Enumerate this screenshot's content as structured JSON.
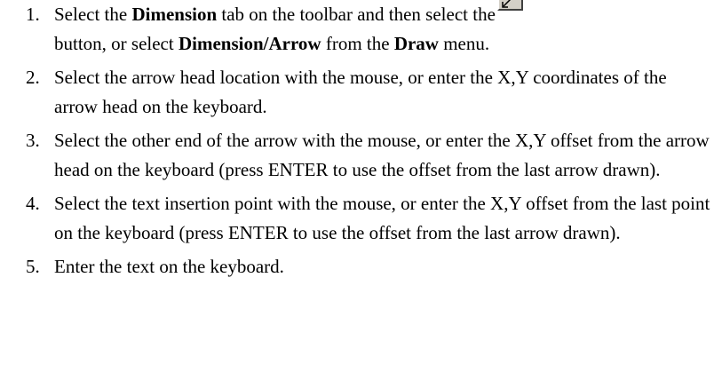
{
  "steps": [
    {
      "number": "1.",
      "line1_before": "Select the ",
      "dimension_tab": "Dimension",
      "line1_after": " tab on the toolbar and then select the",
      "button_icon": "dimension-arrow-icon",
      "line2_before": "button, or select ",
      "menu_item": "Dimension/Arrow",
      "line2_middle": " from the ",
      "menu_name": "Draw",
      "line2_after": " menu."
    },
    {
      "number": "2.",
      "text": "Select the arrow head location with the mouse, or enter the X,Y coordinates of the arrow head on the keyboard."
    },
    {
      "number": "3.",
      "text": "Select the other end of the arrow with the mouse, or enter the X,Y offset from the arrow head on the keyboard (press ENTER to use the offset from the last arrow drawn)."
    },
    {
      "number": "4.",
      "text": "Select the text insertion point with the mouse, or enter the X,Y offset from the last point on the keyboard (press ENTER to use the offset from the last arrow drawn)."
    },
    {
      "number": "5.",
      "text": "Enter the text on the keyboard."
    }
  ]
}
